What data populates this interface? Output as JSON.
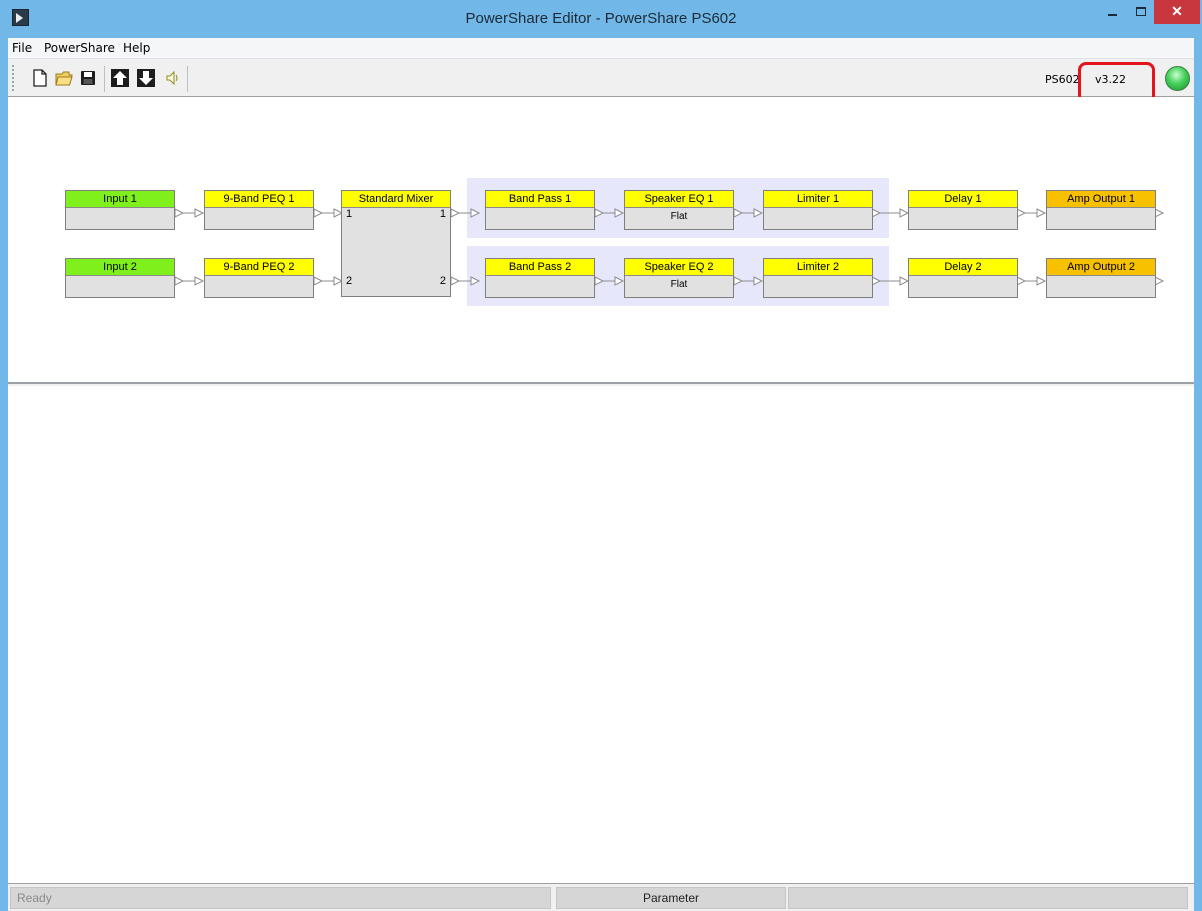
{
  "window": {
    "title": "PowerShare Editor - PowerShare PS602",
    "min_glyph": "–",
    "close_glyph": "✕"
  },
  "menu": [
    "File",
    "PowerShare",
    "Help"
  ],
  "toolbar": {
    "icons": [
      "new-file-icon",
      "open-folder-icon",
      "save-disk-icon",
      "upload-arrow-icon",
      "download-arrow-icon",
      "speaker-icon"
    ],
    "device_model": "PS602",
    "firmware_version": "v3.22",
    "status_led_color": "#45d05a"
  },
  "diagram": {
    "channel1": {
      "input": "Input 1",
      "peq": "9-Band PEQ 1",
      "band_pass": "Band Pass 1",
      "speaker_eq": "Speaker EQ 1",
      "speaker_eq_value": "Flat",
      "limiter": "Limiter 1",
      "delay": "Delay 1",
      "output": "Amp Output 1"
    },
    "channel2": {
      "input": "Input 2",
      "peq": "9-Band PEQ 2",
      "band_pass": "Band Pass 2",
      "speaker_eq": "Speaker EQ 2",
      "speaker_eq_value": "Flat",
      "limiter": "Limiter 2",
      "delay": "Delay 2",
      "output": "Amp Output 2"
    },
    "mixer": {
      "label": "Standard Mixer",
      "in1": "1",
      "in2": "2",
      "out1": "1",
      "out2": "2"
    },
    "colors": {
      "input_header": "#7ff01c",
      "processor_header": "#ffff00",
      "output_header": "#f8c100",
      "group_background": "#e6e7fb"
    }
  },
  "status": {
    "left": "Ready",
    "middle": "Parameter"
  }
}
